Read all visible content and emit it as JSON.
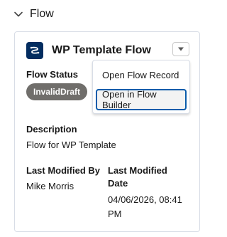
{
  "section": {
    "title": "Flow"
  },
  "card": {
    "title": "WP Template Flow",
    "status_label": "Flow Status",
    "status_badge": "InvalidDraft",
    "description_label": "Description",
    "description_value": "Flow for WP Template",
    "modified_by_label": "Last Modified By",
    "modified_by_value": "Mike Morris",
    "modified_date_label_line1": "Last Modified",
    "modified_date_label_line2": "Date",
    "modified_date_value_line1": "04/06/2026, 08:41",
    "modified_date_value_line2": "PM"
  },
  "menu": {
    "items": [
      {
        "label": "Open Flow Record"
      },
      {
        "label": "Open in Flow Builder"
      }
    ]
  },
  "colors": {
    "icon_bg": "#032d60",
    "badge_bg": "#706e6b",
    "focus_border": "#0b5cab"
  }
}
